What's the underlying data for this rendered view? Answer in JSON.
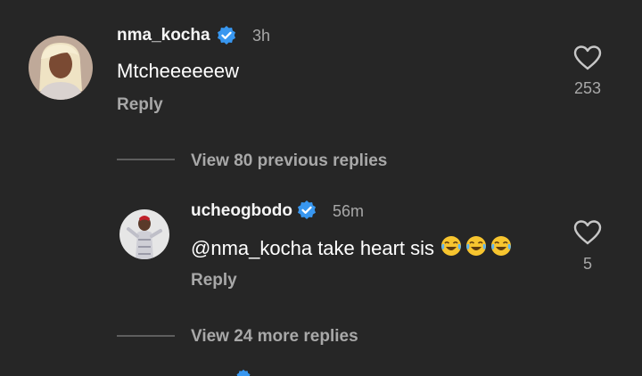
{
  "comment": {
    "username": "nma_kocha",
    "time": "3h",
    "text": "Mtcheeeeeew",
    "reply_label": "Reply",
    "likes": "253"
  },
  "view_previous_label": "View 80 previous replies",
  "reply_comment": {
    "username": "ucheogbodo",
    "time": "56m",
    "mention": "@nma_kocha",
    "text": " take heart sis",
    "emoji": "face-with-tears-of-joy ×3",
    "reply_label": "Reply",
    "likes": "5"
  },
  "view_more_label": "View 24 more replies",
  "colors": {
    "background": "#262626",
    "verified": "#3897f0",
    "secondary_text": "#a8a8a8"
  }
}
